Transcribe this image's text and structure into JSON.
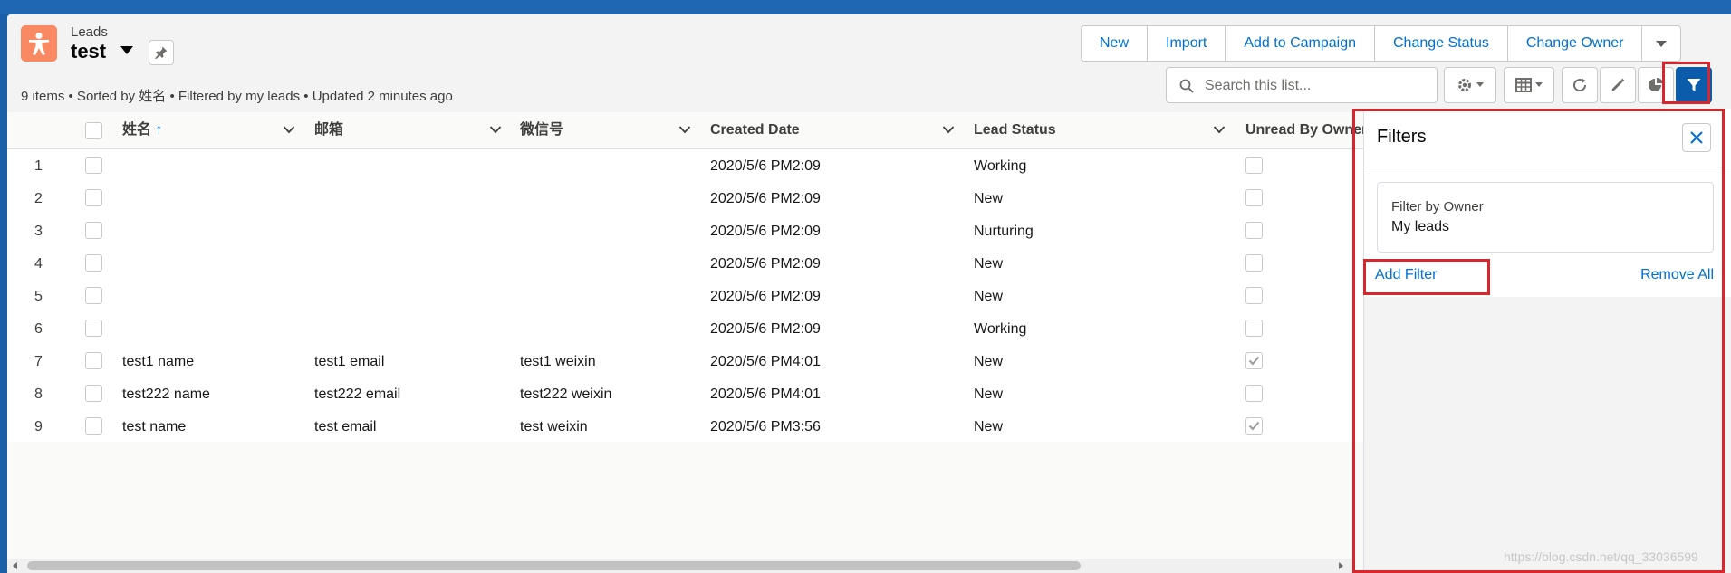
{
  "header": {
    "object_label": "Leads",
    "list_title": "test",
    "subtitle": "9 items • Sorted by 姓名 • Filtered by my leads • Updated 2 minutes ago"
  },
  "actions": {
    "new": "New",
    "import": "Import",
    "add_to_campaign": "Add to Campaign",
    "change_status": "Change Status",
    "change_owner": "Change Owner"
  },
  "search": {
    "placeholder": "Search this list..."
  },
  "table": {
    "columns": [
      "姓名",
      "邮箱",
      "微信号",
      "Created Date",
      "Lead Status",
      "Unread By Owner"
    ],
    "rows": [
      {
        "num": "1",
        "name": "",
        "email": "",
        "wechat": "",
        "created": "2020/5/6 PM2:09",
        "status": "Working",
        "unread": false
      },
      {
        "num": "2",
        "name": "",
        "email": "",
        "wechat": "",
        "created": "2020/5/6 PM2:09",
        "status": "New",
        "unread": false
      },
      {
        "num": "3",
        "name": "",
        "email": "",
        "wechat": "",
        "created": "2020/5/6 PM2:09",
        "status": "Nurturing",
        "unread": false
      },
      {
        "num": "4",
        "name": "",
        "email": "",
        "wechat": "",
        "created": "2020/5/6 PM2:09",
        "status": "New",
        "unread": false
      },
      {
        "num": "5",
        "name": "",
        "email": "",
        "wechat": "",
        "created": "2020/5/6 PM2:09",
        "status": "New",
        "unread": false
      },
      {
        "num": "6",
        "name": "",
        "email": "",
        "wechat": "",
        "created": "2020/5/6 PM2:09",
        "status": "Working",
        "unread": false
      },
      {
        "num": "7",
        "name": "test1 name",
        "email": "test1 email",
        "wechat": "test1 weixin",
        "created": "2020/5/6 PM4:01",
        "status": "New",
        "unread": true
      },
      {
        "num": "8",
        "name": "test222 name",
        "email": "test222 email",
        "wechat": "test222 weixin",
        "created": "2020/5/6 PM4:01",
        "status": "New",
        "unread": false
      },
      {
        "num": "9",
        "name": "test name",
        "email": "test email",
        "wechat": "test weixin",
        "created": "2020/5/6 PM3:56",
        "status": "New",
        "unread": true
      }
    ]
  },
  "filters": {
    "title": "Filters",
    "owner_label": "Filter by Owner",
    "owner_value": "My leads",
    "add_filter": "Add Filter",
    "remove_all": "Remove All"
  },
  "watermark": "https://blog.csdn.net/qq_33036599",
  "colors": {
    "brand_blue": "#0070d2",
    "lead_icon": "#f88962",
    "highlight": "#d9262d"
  }
}
